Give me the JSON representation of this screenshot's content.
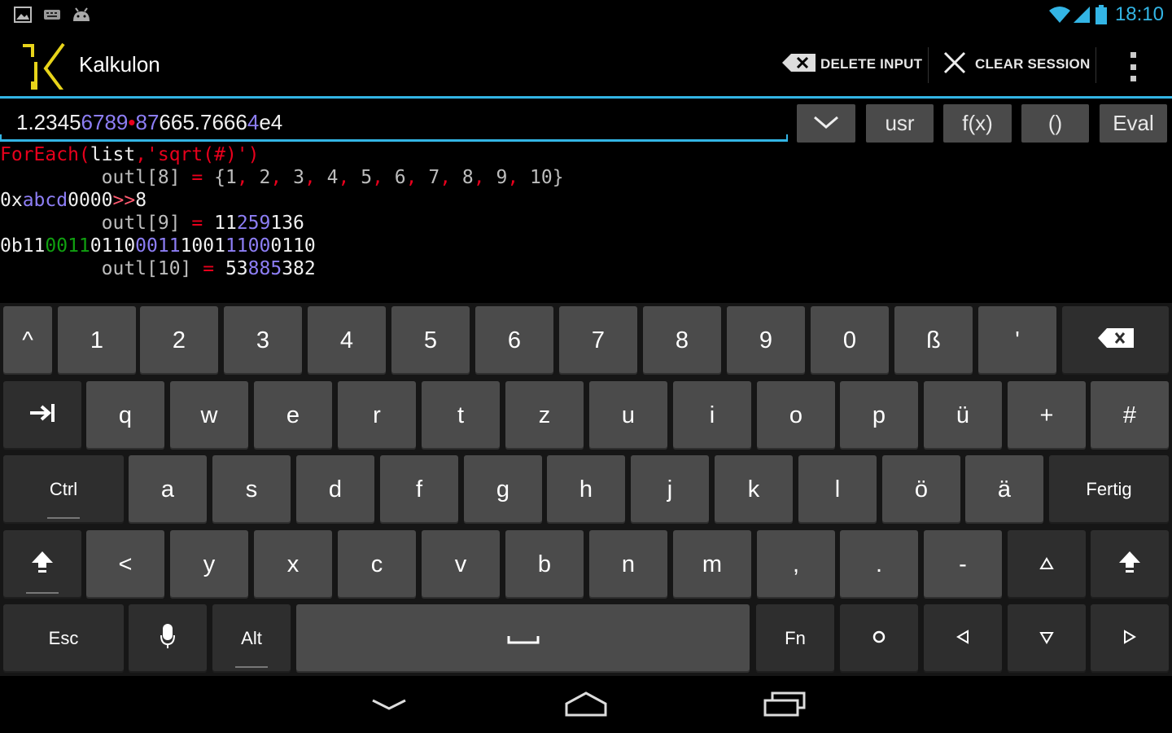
{
  "status_bar": {
    "left_icons": [
      "image-icon",
      "keyboard-icon",
      "android-icon"
    ],
    "right_icons": [
      "wifi-icon",
      "signal-icon",
      "battery-icon"
    ],
    "clock": "18:10"
  },
  "action_bar": {
    "title": "Kalkulon",
    "delete_input": "DELETE INPUT",
    "clear_session": "CLEAR SESSION",
    "overflow_icon": "overflow-menu-icon"
  },
  "input": {
    "expression_parts": [
      {
        "text": "1.2345",
        "color": "#f0f0f0"
      },
      {
        "text": "6789",
        "color": "#8d7ef5"
      },
      {
        "text": "•",
        "color": "#e8001c"
      },
      {
        "text": "87",
        "color": "#8d7ef5"
      },
      {
        "text": "665.7666",
        "color": "#f0f0f0"
      },
      {
        "text": "4",
        "color": "#8d7ef5"
      },
      {
        "text": "e4",
        "color": "#f0f0f0"
      }
    ],
    "buttons": {
      "dropdown_icon": "chevron-down-icon",
      "usr": "usr",
      "fx": "f(x)",
      "parens": "()",
      "eval": "Eval"
    }
  },
  "console": {
    "line1": [
      {
        "t": "ForEach(",
        "c": "#e8001c"
      },
      {
        "t": "list",
        "c": "#f0f0f0"
      },
      {
        "t": ",'sqrt(#)')",
        "c": "#e8001c"
      }
    ],
    "line2": [
      {
        "t": "         outl[8] ",
        "c": "#bdbdbd"
      },
      {
        "t": "=",
        "c": "#e8001c"
      },
      {
        "t": " {1",
        "c": "#bdbdbd"
      },
      {
        "t": ",",
        "c": "#e8001c"
      },
      {
        "t": " 2",
        "c": "#bdbdbd"
      },
      {
        "t": ",",
        "c": "#e8001c"
      },
      {
        "t": " 3",
        "c": "#bdbdbd"
      },
      {
        "t": ",",
        "c": "#e8001c"
      },
      {
        "t": " 4",
        "c": "#bdbdbd"
      },
      {
        "t": ",",
        "c": "#e8001c"
      },
      {
        "t": " 5",
        "c": "#bdbdbd"
      },
      {
        "t": ",",
        "c": "#e8001c"
      },
      {
        "t": " 6",
        "c": "#bdbdbd"
      },
      {
        "t": ",",
        "c": "#e8001c"
      },
      {
        "t": " 7",
        "c": "#bdbdbd"
      },
      {
        "t": ",",
        "c": "#e8001c"
      },
      {
        "t": " 8",
        "c": "#bdbdbd"
      },
      {
        "t": ",",
        "c": "#e8001c"
      },
      {
        "t": " 9",
        "c": "#bdbdbd"
      },
      {
        "t": ",",
        "c": "#e8001c"
      },
      {
        "t": " 10}",
        "c": "#bdbdbd"
      }
    ],
    "line3": [
      {
        "t": "0x",
        "c": "#f0f0f0"
      },
      {
        "t": "abcd",
        "c": "#8d7ef5"
      },
      {
        "t": "0000",
        "c": "#f0f0f0"
      },
      {
        "t": ">>",
        "c": "#ff5a70"
      },
      {
        "t": "8",
        "c": "#f0f0f0"
      }
    ],
    "line4": [
      {
        "t": "         outl[9] ",
        "c": "#bdbdbd"
      },
      {
        "t": "=",
        "c": "#e8001c"
      },
      {
        "t": " 11",
        "c": "#f0f0f0"
      },
      {
        "t": "259",
        "c": "#8d7ef5"
      },
      {
        "t": "136",
        "c": "#f0f0f0"
      }
    ],
    "line5": [
      {
        "t": "0b11",
        "c": "#f0f0f0"
      },
      {
        "t": "0011",
        "c": "#10a010"
      },
      {
        "t": "0110",
        "c": "#f0f0f0"
      },
      {
        "t": "0011",
        "c": "#8d7ef5"
      },
      {
        "t": "1001",
        "c": "#f0f0f0"
      },
      {
        "t": "1100",
        "c": "#8d7ef5"
      },
      {
        "t": "0110",
        "c": "#f0f0f0"
      }
    ],
    "line6": [
      {
        "t": "         outl[10] ",
        "c": "#bdbdbd"
      },
      {
        "t": "=",
        "c": "#e8001c"
      },
      {
        "t": " 53",
        "c": "#f0f0f0"
      },
      {
        "t": "885",
        "c": "#8d7ef5"
      },
      {
        "t": "382",
        "c": "#f0f0f0"
      }
    ]
  },
  "keyboard": {
    "row1": [
      "^",
      "1",
      "2",
      "3",
      "4",
      "5",
      "6",
      "7",
      "8",
      "9",
      "0",
      "ß",
      "'"
    ],
    "row1_backspace_icon": "backspace-icon",
    "row2_tab_icon": "tab-icon",
    "row2": [
      "q",
      "w",
      "e",
      "r",
      "t",
      "z",
      "u",
      "i",
      "o",
      "p",
      "ü",
      "+",
      "#"
    ],
    "row3_ctrl": "Ctrl",
    "row3": [
      "a",
      "s",
      "d",
      "f",
      "g",
      "h",
      "j",
      "k",
      "l",
      "ö",
      "ä"
    ],
    "row3_done": "Fertig",
    "row4_shift_icon": "shift-icon",
    "row4": [
      "<",
      "y",
      "x",
      "c",
      "v",
      "b",
      "n",
      "m",
      ",",
      ".",
      "-"
    ],
    "row4_up_icon": "arrow-up-icon",
    "row4_shift_right_icon": "shift-icon",
    "row5_esc": "Esc",
    "row5_mic_icon": "microphone-icon",
    "row5_alt": "Alt",
    "row5_space_icon": "space-icon",
    "row5_fn": "Fn",
    "row5_circle_icon": "circle-icon",
    "row5_left_icon": "arrow-left-icon",
    "row5_down_icon": "arrow-down-icon",
    "row5_right_icon": "arrow-right-icon"
  },
  "nav_bar": {
    "back_icon": "back-icon",
    "home_icon": "home-icon",
    "recents_icon": "recents-icon"
  }
}
